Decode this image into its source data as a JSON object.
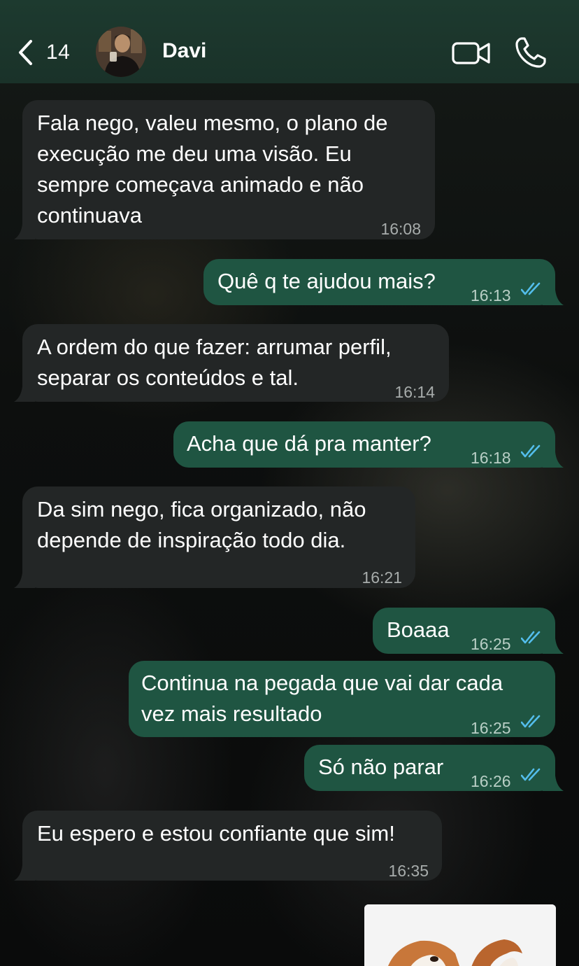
{
  "header": {
    "back_count": "14",
    "contact_name": "Davi"
  },
  "colors": {
    "header_bg": "#1d3a2f",
    "incoming_bubble": "#232626",
    "outgoing_bubble": "#1f5542",
    "read_ticks": "#53bdeb"
  },
  "icons": [
    "chevron-left-icon",
    "video-call-icon",
    "phone-icon",
    "read-receipt-icon"
  ],
  "messages": [
    {
      "dir": "in",
      "text": "Fala nego, valeu mesmo, o plano de\nexecução me deu uma visão. Eu\nsempre começava animado e não\ncontinuava",
      "time": "16:08"
    },
    {
      "dir": "out",
      "text": "Quê q te ajudou mais?",
      "time": "16:13"
    },
    {
      "dir": "in",
      "text": "A ordem do que fazer: arrumar perfil,\nseparar os conteúdos e tal.",
      "time": "16:14"
    },
    {
      "dir": "out",
      "text": "Acha que dá pra manter?",
      "time": "16:18"
    },
    {
      "dir": "in",
      "text": "Da sim nego, fica organizado, não\ndepende de inspiração todo dia.",
      "time": "16:21"
    },
    {
      "dir": "out",
      "text": "Boaaa",
      "time": "16:25"
    },
    {
      "dir": "out",
      "text": "Continua na pegada que vai dar cada\nvez mais resultado",
      "time": "16:25"
    },
    {
      "dir": "out",
      "text": "Só não parar",
      "time": "16:26"
    },
    {
      "dir": "in",
      "text": "Eu espero e estou confiante que sim!",
      "time": "16:35"
    }
  ]
}
